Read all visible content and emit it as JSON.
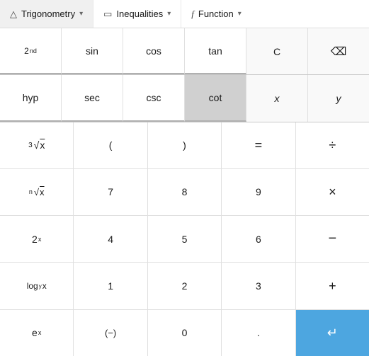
{
  "menu": {
    "items": [
      {
        "icon": "△",
        "label": "Trigonometry",
        "chevron": "▾"
      },
      {
        "icon": "▭",
        "label": "Inequalities",
        "chevron": "▾"
      },
      {
        "icon": "𝑓",
        "label": "Function",
        "chevron": "▾"
      }
    ]
  },
  "rows": [
    [
      {
        "label": "2ⁿᵈ",
        "type": "superscript",
        "name": "second-button",
        "interactable": true,
        "highlight": false
      },
      {
        "label": "sin",
        "type": "text",
        "name": "sin-button",
        "interactable": true,
        "highlight": false
      },
      {
        "label": "cos",
        "type": "text",
        "name": "cos-button",
        "interactable": true,
        "highlight": false
      },
      {
        "label": "tan",
        "type": "text",
        "name": "tan-button",
        "interactable": true,
        "highlight": false
      },
      {
        "label": "C",
        "type": "text",
        "name": "clear-button",
        "interactable": true,
        "highlight": false
      },
      {
        "label": "⌫",
        "type": "backspace",
        "name": "backspace-button",
        "interactable": true,
        "highlight": false
      }
    ],
    [
      {
        "label": "hyp",
        "type": "text",
        "name": "hyp-button",
        "interactable": true,
        "highlight": false
      },
      {
        "label": "sec",
        "type": "text",
        "name": "sec-button",
        "interactable": true,
        "highlight": false
      },
      {
        "label": "csc",
        "type": "text",
        "name": "csc-button",
        "interactable": true,
        "highlight": false
      },
      {
        "label": "cot",
        "type": "text",
        "name": "cot-button",
        "interactable": true,
        "highlight": true
      },
      {
        "label": "x",
        "type": "italic",
        "name": "x-button",
        "interactable": true,
        "highlight": false
      },
      {
        "label": "y",
        "type": "italic",
        "name": "y-button",
        "interactable": true,
        "highlight": false
      }
    ],
    [
      {
        "label": "∛x",
        "type": "math",
        "name": "cube-root-button",
        "interactable": true,
        "highlight": false
      },
      {
        "label": "(",
        "type": "text",
        "name": "open-paren-button",
        "interactable": true,
        "highlight": false
      },
      {
        "label": ")",
        "type": "text",
        "name": "close-paren-button",
        "interactable": true,
        "highlight": false
      },
      {
        "label": "=",
        "type": "text",
        "name": "equals-button",
        "interactable": true,
        "highlight": false
      },
      {
        "label": "÷",
        "type": "text",
        "name": "divide-button",
        "interactable": true,
        "highlight": false
      }
    ],
    [
      {
        "label": "ⁿ√x",
        "type": "math",
        "name": "nth-root-button",
        "interactable": true,
        "highlight": false
      },
      {
        "label": "7",
        "type": "text",
        "name": "seven-button",
        "interactable": true,
        "highlight": false
      },
      {
        "label": "8",
        "type": "text",
        "name": "eight-button",
        "interactable": true,
        "highlight": false
      },
      {
        "label": "9",
        "type": "text",
        "name": "nine-button",
        "interactable": true,
        "highlight": false
      },
      {
        "label": "×",
        "type": "text",
        "name": "multiply-button",
        "interactable": true,
        "highlight": false
      }
    ],
    [
      {
        "label": "2ˣ",
        "type": "math",
        "name": "power-button",
        "interactable": true,
        "highlight": false
      },
      {
        "label": "4",
        "type": "text",
        "name": "four-button",
        "interactable": true,
        "highlight": false
      },
      {
        "label": "5",
        "type": "text",
        "name": "five-button",
        "interactable": true,
        "highlight": false
      },
      {
        "label": "6",
        "type": "text",
        "name": "six-button",
        "interactable": true,
        "highlight": false
      },
      {
        "label": "−",
        "type": "text",
        "name": "subtract-button",
        "interactable": true,
        "highlight": false
      }
    ],
    [
      {
        "label": "logᵧx",
        "type": "math",
        "name": "log-button",
        "interactable": true,
        "highlight": false
      },
      {
        "label": "1",
        "type": "text",
        "name": "one-button",
        "interactable": true,
        "highlight": false
      },
      {
        "label": "2",
        "type": "text",
        "name": "two-button",
        "interactable": true,
        "highlight": false
      },
      {
        "label": "3",
        "type": "text",
        "name": "three-button",
        "interactable": true,
        "highlight": false
      },
      {
        "label": "+",
        "type": "text",
        "name": "add-button",
        "interactable": true,
        "highlight": false
      }
    ],
    [
      {
        "label": "eˣ",
        "type": "math",
        "name": "exp-button",
        "interactable": true,
        "highlight": false
      },
      {
        "label": "(−)",
        "type": "text",
        "name": "negate-button",
        "interactable": true,
        "highlight": false
      },
      {
        "label": "0",
        "type": "text",
        "name": "zero-button",
        "interactable": true,
        "highlight": false
      },
      {
        "label": ".",
        "type": "text",
        "name": "decimal-button",
        "interactable": true,
        "highlight": false
      },
      {
        "label": "↵",
        "type": "enter",
        "name": "enter-button",
        "interactable": true,
        "highlight": false,
        "accent": true
      }
    ]
  ],
  "colors": {
    "accent_blue": "#4da6e0",
    "highlight_gray": "#d0d0d0",
    "trig_border": "#c0c0c0"
  }
}
